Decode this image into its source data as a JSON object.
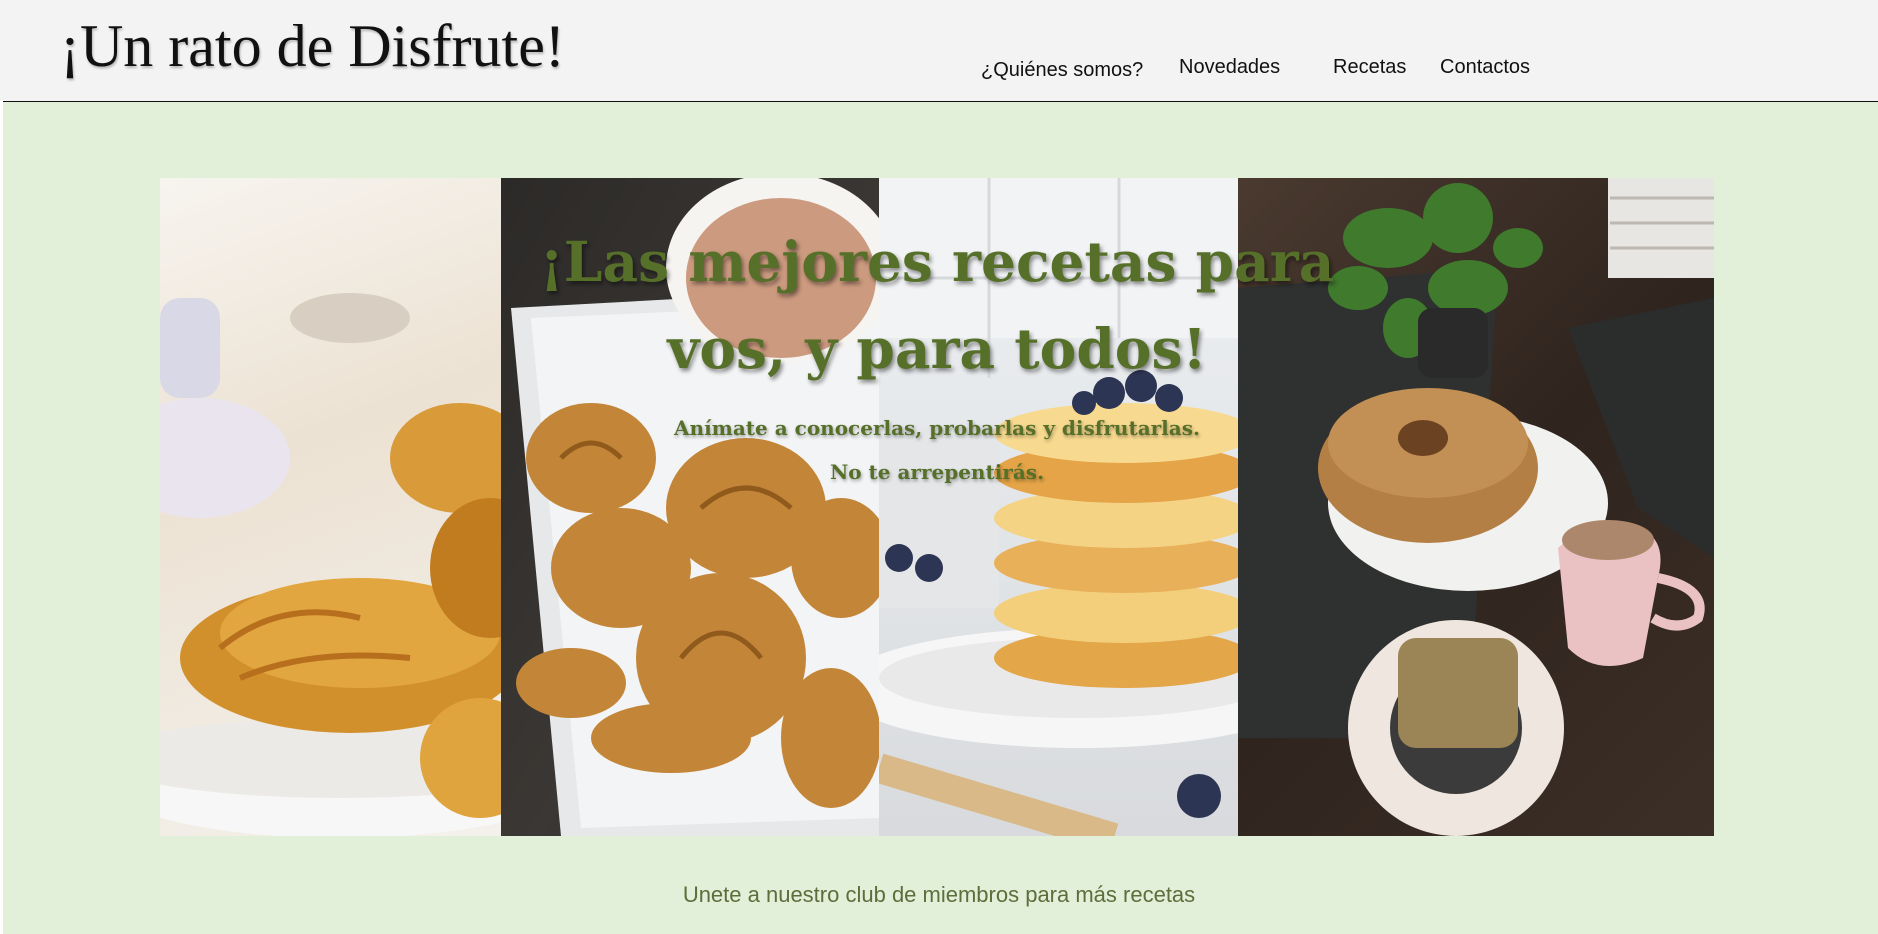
{
  "header": {
    "title": "¡Un rato de Disfrute!",
    "nav": [
      "¿Quiénes somos?",
      "Novedades",
      "Recetas",
      "Contactos"
    ]
  },
  "hero": {
    "title_line1": "¡Las mejores recetas para",
    "title_line2": "vos, y para todos!",
    "subtitle_line1": "Anímate a conocerlas, probarlas y disfrutarlas.",
    "subtitle_line2": "No te arrepentirás."
  },
  "footer": {
    "club_link": "Unete a nuestro club de miembros para más recetas"
  },
  "colors": {
    "background": "#e2efd9",
    "header": "#f3f3f3",
    "accent_green": "#56702a",
    "link_green": "#5d6e3b"
  }
}
